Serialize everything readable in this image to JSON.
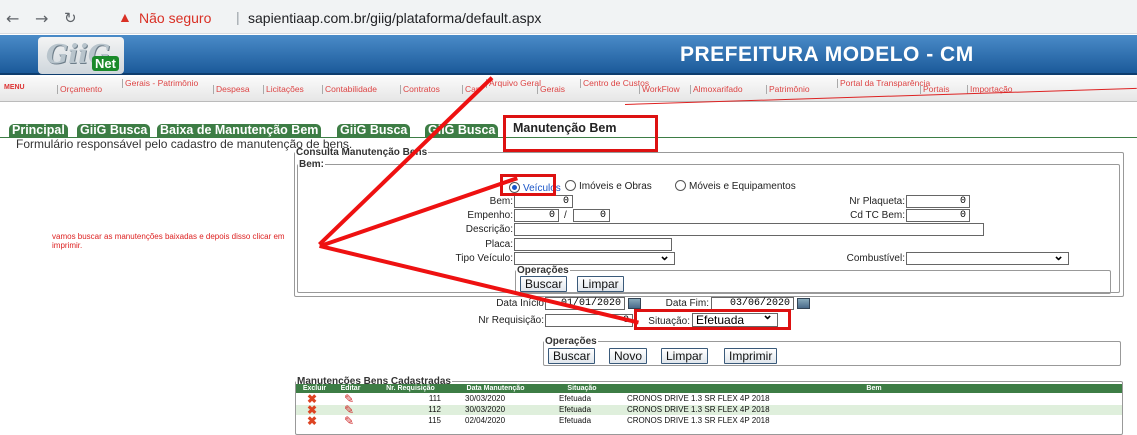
{
  "browser": {
    "security": "Não seguro",
    "url": "sapientiaap.com.br/giig/plataforma/default.aspx"
  },
  "header": {
    "logo": "GiiG",
    "logo_tag": "Net",
    "title": "PREFEITURA MODELO - CM"
  },
  "menu": {
    "label": "MENU",
    "items": [
      "Orçamento",
      "Gerais - Patrimônio",
      "Despesa",
      "Licitações",
      "Contabilidade",
      "Contratos",
      "Cap",
      "Arquivo Geral",
      "Gerais",
      "Centro de Custos",
      "WorkFlow",
      "Almoxarifado",
      "Patrimônio",
      "Portal da Transparência",
      "Portais",
      "Importação"
    ]
  },
  "tabs": [
    "Principal",
    "GiiG Busca",
    "Baixa de Manutenção Bem",
    "GiiG Busca",
    "GiiG Busca",
    "Manutenção Bem"
  ],
  "form_desc": "Formulário responsável pelo cadastro de manutenção de bens.",
  "consulta": {
    "legend": "Consulta Manutenção Bens",
    "bem_legend": "Bem:",
    "radios": [
      "Veículos",
      "Imóveis e Obras",
      "Móveis e Equipamentos"
    ],
    "bem_label": "Bem:",
    "bem_value": "0",
    "plaqueta_label": "Nr Plaqueta:",
    "plaqueta_value": "0",
    "empenho_label": "Empenho:",
    "empenho_v1": "0",
    "empenho_sep": "/",
    "empenho_v2": "0",
    "cdtc_label": "Cd TC Bem:",
    "cdtc_value": "0",
    "descricao_label": "Descrição:",
    "placa_label": "Placa:",
    "tipo_label": "Tipo Veículo:",
    "combustivel_label": "Combustível:",
    "ops_legend": "Operações",
    "buscar": "Buscar",
    "limpar": "Limpar"
  },
  "filtros": {
    "data_inicio_label": "Data Início",
    "data_inicio": "01/01/2020",
    "data_fim_label": "Data Fim:",
    "data_fim": "03/06/2020",
    "requisicao_label": "Nr Requisição:",
    "requisicao_value": "0",
    "situacao_label": "Situação:",
    "situacao_value": "Efetuada",
    "ops_legend": "Operações",
    "buscar": "Buscar",
    "novo": "Novo",
    "limpar": "Limpar",
    "imprimir": "Imprimir"
  },
  "annotation": "vamos buscar as manutenções baixadas e depois disso clicar em imprimir.",
  "table": {
    "legend": "Manutenções Bens Cadastradas",
    "headers": [
      "Excluir",
      "Editar",
      "Nr. Requisição",
      "Data Manutenção",
      "Situação",
      "Bem"
    ],
    "rows": [
      {
        "req": "111",
        "data": "30/03/2020",
        "situacao": "Efetuada",
        "bem": "CRONOS DRIVE 1.3 SR FLEX 4P 2018"
      },
      {
        "req": "112",
        "data": "30/03/2020",
        "situacao": "Efetuada",
        "bem": "CRONOS DRIVE 1.3 SR FLEX 4P 2018"
      },
      {
        "req": "115",
        "data": "02/04/2020",
        "situacao": "Efetuada",
        "bem": "CRONOS DRIVE 1.3 SR FLEX 4P 2018"
      }
    ]
  },
  "colors": {
    "accent_green": "#3d7d45",
    "annotation_red": "#e11",
    "header_blue": "#2a6aac"
  }
}
